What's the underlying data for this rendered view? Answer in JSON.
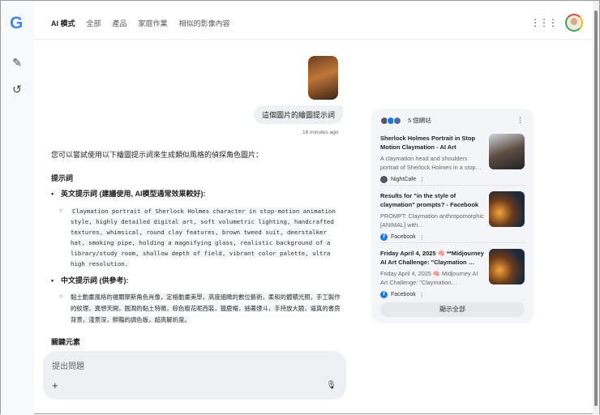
{
  "header": {
    "logo": "G",
    "tabs": [
      "AI 模式",
      "全部",
      "產品",
      "家庭作業",
      "相似的影像內容"
    ],
    "apps_icon": "apps-grid-icon"
  },
  "rail": {
    "icons": [
      "new-chat-icon",
      "history-icon"
    ]
  },
  "chat": {
    "user_message": "這個圖片的繪圖提示詞",
    "timestamp": "16 minutes ago"
  },
  "answer": {
    "intro": "您可以嘗試使用以下繪圖提示詞來生成類似風格的偵探角色圖片：",
    "section1": "提示詞",
    "en_label": "英文提示詞 (建議使用, AI模型通常效果較好):",
    "en_prompt": "Claymation portrait of Sherlock Holmes character in stop-motion animation style, highly detailed digital art, soft volumetric lighting, handcrafted textures, whimsical, round clay features, brown tweed suit, deerstalker hat, smoking pipe, holding a magnifying glass, realistic background of a library/study room, shallow depth of field, vibrant color palette, ultra high resolution.",
    "zh_label": "中文提示詞 (供參考):",
    "zh_prompt": "黏土動畫風格的福爾摩斯角色肖像，定格動畫美學，高度細緻的數位藝術，柔和的體積光照，手工製作的紋理，異想天開，圓潤的黏土特徵，棕色粗花呢西裝，獵鹿帽，抽著煙斗，手持放大鏡，逼真的書房背景，淺景深，鮮豔的調色板，超高解析度。",
    "section2": "關鍵元素"
  },
  "input": {
    "placeholder": "提出問題",
    "plus": "+",
    "mic": "🎙"
  },
  "sources": {
    "count_label": "5 個網站",
    "items": [
      {
        "title": "Sherlock Holmes Portrait in Stop Motion Claymation - AI Art",
        "desc": "A claymation head and shoulders portrait of Sherlock Holmes in a stop…",
        "source": "NightCafe"
      },
      {
        "title": "Results for \"in the style of claymation\" prompts? - Facebook",
        "desc": "PROMPT: Claymation anthropomorphic [ANIMAL] with…",
        "source": "Facebook"
      },
      {
        "title": "Friday April 4, 2025 🧠 **Midjourney AI Art Challenge: \"Claymation …",
        "desc": "Friday April 4, 2025 🧠 Midjourney AI Art Challenge: \"Claymation…",
        "source": "Facebook"
      }
    ],
    "show_all": "顯示全部"
  }
}
